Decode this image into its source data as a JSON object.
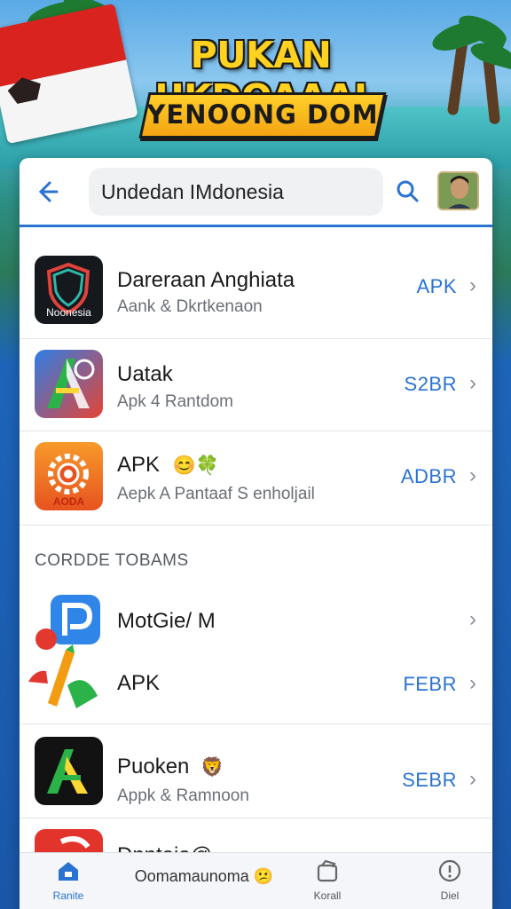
{
  "banner": {
    "title": "PUKAN UKDOAAAI",
    "subtitle": "YENOONG DOM"
  },
  "search": {
    "value": "Undedan IMdonesia"
  },
  "apps": [
    {
      "title": "Dareraan Anghiata",
      "subtitle": "Aank & Dkrtkenaon",
      "action": "APK",
      "icon_name": "shield-app-icon",
      "icon_label": "Noonesia"
    },
    {
      "title": "Uatak",
      "subtitle": "Apk 4 Rantdom",
      "action": "S2BR",
      "icon_name": "letter-a-app-icon"
    },
    {
      "title": "APK",
      "subtitle": "Aepk A Pantaaf S enholjail",
      "action": "ADBR",
      "icon_name": "gear-app-icon",
      "icon_label": "AODA",
      "emoji": "😊🍀"
    }
  ],
  "section": {
    "title": "CORDDE TOBAMS"
  },
  "apps2": [
    {
      "title": "MotGie/ M",
      "icon_name": "letter-p-app-icon"
    },
    {
      "title": "APK",
      "action": "FEBR",
      "icon_name": "pencil-app-icon"
    },
    {
      "title": "Puoken",
      "subtitle": "Appk & Ramnoon",
      "action": "SEBR",
      "icon_name": "letter-a-dark-app-icon",
      "emoji": "🦁"
    },
    {
      "title": "Dnntaia@",
      "icon_name": "red-app-icon"
    }
  ],
  "bottom_nav": {
    "items": [
      {
        "label": "Ranite",
        "icon": "home-icon"
      },
      {
        "label": "Oomamaunoma 😕",
        "icon": "none"
      },
      {
        "label": "Korall",
        "icon": "package-icon"
      },
      {
        "label": "Diel",
        "icon": "info-icon"
      }
    ]
  },
  "colors": {
    "accent": "#2a73d1",
    "banner_yellow": "#ffd21f",
    "flag_red": "#d9231f"
  }
}
